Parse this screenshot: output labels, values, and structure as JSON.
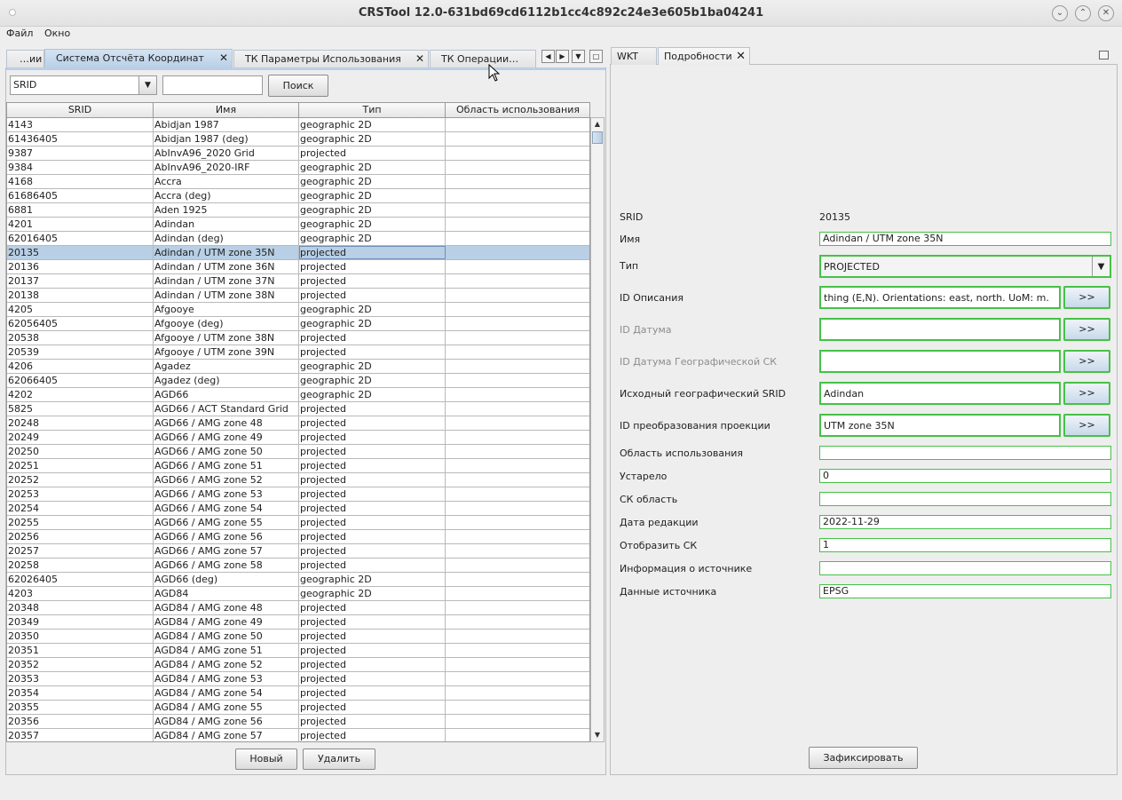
{
  "window": {
    "title": "CRSTool 12.0-631bd69cd6112b1cc4c892c24e3e605b1ba04241",
    "min_glyph": "⌄",
    "max_glyph": "⌃",
    "close_glyph": "✕"
  },
  "menu": {
    "file": "Файл",
    "window": "Окно"
  },
  "left_tabs": [
    {
      "label": "…ии"
    },
    {
      "label": "Система Отсчёта Координат",
      "active": true
    },
    {
      "label": "ТК Параметры Использования"
    },
    {
      "label": "ТК Операции…"
    }
  ],
  "tab_close_glyph": "✕",
  "right_tabs": [
    {
      "label": "WKT"
    },
    {
      "label": "Подробности",
      "active": true
    }
  ],
  "search": {
    "field_select": "SRID",
    "query": "",
    "button": "Поиск"
  },
  "table": {
    "columns": [
      "SRID",
      "Имя",
      "Тип",
      "Область использования"
    ],
    "selected_index": 9,
    "rows": [
      [
        "4143",
        "Abidjan 1987",
        "geographic 2D",
        ""
      ],
      [
        "61436405",
        "Abidjan 1987 (deg)",
        "geographic 2D",
        ""
      ],
      [
        "9387",
        "AbInvA96_2020 Grid",
        "projected",
        ""
      ],
      [
        "9384",
        "AbInvA96_2020-IRF",
        "geographic 2D",
        ""
      ],
      [
        "4168",
        "Accra",
        "geographic 2D",
        ""
      ],
      [
        "61686405",
        "Accra (deg)",
        "geographic 2D",
        ""
      ],
      [
        "6881",
        "Aden 1925",
        "geographic 2D",
        ""
      ],
      [
        "4201",
        "Adindan",
        "geographic 2D",
        ""
      ],
      [
        "62016405",
        "Adindan (deg)",
        "geographic 2D",
        ""
      ],
      [
        "20135",
        "Adindan / UTM zone 35N",
        "projected",
        ""
      ],
      [
        "20136",
        "Adindan / UTM zone 36N",
        "projected",
        ""
      ],
      [
        "20137",
        "Adindan / UTM zone 37N",
        "projected",
        ""
      ],
      [
        "20138",
        "Adindan / UTM zone 38N",
        "projected",
        ""
      ],
      [
        "4205",
        "Afgooye",
        "geographic 2D",
        ""
      ],
      [
        "62056405",
        "Afgooye (deg)",
        "geographic 2D",
        ""
      ],
      [
        "20538",
        "Afgooye / UTM zone 38N",
        "projected",
        ""
      ],
      [
        "20539",
        "Afgooye / UTM zone 39N",
        "projected",
        ""
      ],
      [
        "4206",
        "Agadez",
        "geographic 2D",
        ""
      ],
      [
        "62066405",
        "Agadez (deg)",
        "geographic 2D",
        ""
      ],
      [
        "4202",
        "AGD66",
        "geographic 2D",
        ""
      ],
      [
        "5825",
        "AGD66 / ACT Standard Grid",
        "projected",
        ""
      ],
      [
        "20248",
        "AGD66 / AMG zone 48",
        "projected",
        ""
      ],
      [
        "20249",
        "AGD66 / AMG zone 49",
        "projected",
        ""
      ],
      [
        "20250",
        "AGD66 / AMG zone 50",
        "projected",
        ""
      ],
      [
        "20251",
        "AGD66 / AMG zone 51",
        "projected",
        ""
      ],
      [
        "20252",
        "AGD66 / AMG zone 52",
        "projected",
        ""
      ],
      [
        "20253",
        "AGD66 / AMG zone 53",
        "projected",
        ""
      ],
      [
        "20254",
        "AGD66 / AMG zone 54",
        "projected",
        ""
      ],
      [
        "20255",
        "AGD66 / AMG zone 55",
        "projected",
        ""
      ],
      [
        "20256",
        "AGD66 / AMG zone 56",
        "projected",
        ""
      ],
      [
        "20257",
        "AGD66 / AMG zone 57",
        "projected",
        ""
      ],
      [
        "20258",
        "AGD66 / AMG zone 58",
        "projected",
        ""
      ],
      [
        "62026405",
        "AGD66 (deg)",
        "geographic 2D",
        ""
      ],
      [
        "4203",
        "AGD84",
        "geographic 2D",
        ""
      ],
      [
        "20348",
        "AGD84 / AMG zone 48",
        "projected",
        ""
      ],
      [
        "20349",
        "AGD84 / AMG zone 49",
        "projected",
        ""
      ],
      [
        "20350",
        "AGD84 / AMG zone 50",
        "projected",
        ""
      ],
      [
        "20351",
        "AGD84 / AMG zone 51",
        "projected",
        ""
      ],
      [
        "20352",
        "AGD84 / AMG zone 52",
        "projected",
        ""
      ],
      [
        "20353",
        "AGD84 / AMG zone 53",
        "projected",
        ""
      ],
      [
        "20354",
        "AGD84 / AMG zone 54",
        "projected",
        ""
      ],
      [
        "20355",
        "AGD84 / AMG zone 55",
        "projected",
        ""
      ],
      [
        "20356",
        "AGD84 / AMG zone 56",
        "projected",
        ""
      ],
      [
        "20357",
        "AGD84 / AMG zone 57",
        "projected",
        ""
      ]
    ]
  },
  "left_buttons": {
    "new": "Новый",
    "delete": "Удалить"
  },
  "details": {
    "srid_label": "SRID",
    "srid_value": "20135",
    "name_label": "Имя",
    "name_value": "Adindan / UTM zone 35N",
    "type_label": "Тип",
    "type_value": "PROJECTED",
    "desc_id_label": "ID Описания",
    "desc_id_value": "thing (E,N). Orientations: east, north. UoM: m.",
    "datum_id_label": "ID Датума",
    "datum_id_value": "",
    "geo_datum_id_label": "ID Датума Географической СК",
    "geo_datum_id_value": "",
    "source_srid_label": "Исходный географический SRID",
    "source_srid_value": "Adindan",
    "proj_id_label": "ID преобразования проекции",
    "proj_id_value": "UTM zone 35N",
    "area_label": "Область использования",
    "area_value": "",
    "deprecated_label": "Устарело",
    "deprecated_value": "0",
    "crs_area_label": "СК область",
    "crs_area_value": "",
    "revision_date_label": "Дата редакции",
    "revision_date_value": "2022-11-29",
    "show_crs_label": "Отобразить СК",
    "show_crs_value": "1",
    "source_info_label": "Информация о источнике",
    "source_info_value": "",
    "source_data_label": "Данные источника",
    "source_data_value": "EPSG",
    "more_button": ">>",
    "commit_button": "Зафиксировать"
  }
}
